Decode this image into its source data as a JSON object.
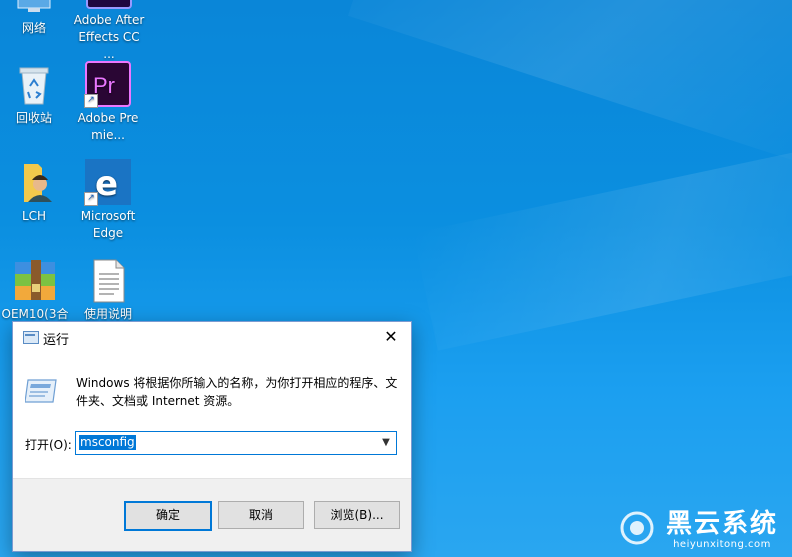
{
  "desktop": {
    "icons": [
      {
        "label": "网络"
      },
      {
        "label": "Adobe After Effects CC ..."
      },
      {
        "label": "回收站"
      },
      {
        "label": "Adobe Premie..."
      },
      {
        "label": "LCH"
      },
      {
        "label": "Microsoft Edge"
      },
      {
        "label": "OEM10(3合"
      },
      {
        "label": "使用说明"
      }
    ]
  },
  "run_dialog": {
    "title": "运行",
    "close_symbol": "✕",
    "description": "Windows 将根据你所输入的名称，为你打开相应的程序、文件夹、文档或 Internet 资源。",
    "open_label": "打开(O):",
    "input_value": "msconfig",
    "buttons": {
      "ok": "确定",
      "cancel": "取消",
      "browse": "浏览(B)..."
    }
  },
  "watermark": {
    "title": "黑云系统",
    "url": "heiyunxitong.com"
  },
  "colors": {
    "desktop_bg": "#0b8fe0",
    "accent": "#0078d7"
  }
}
